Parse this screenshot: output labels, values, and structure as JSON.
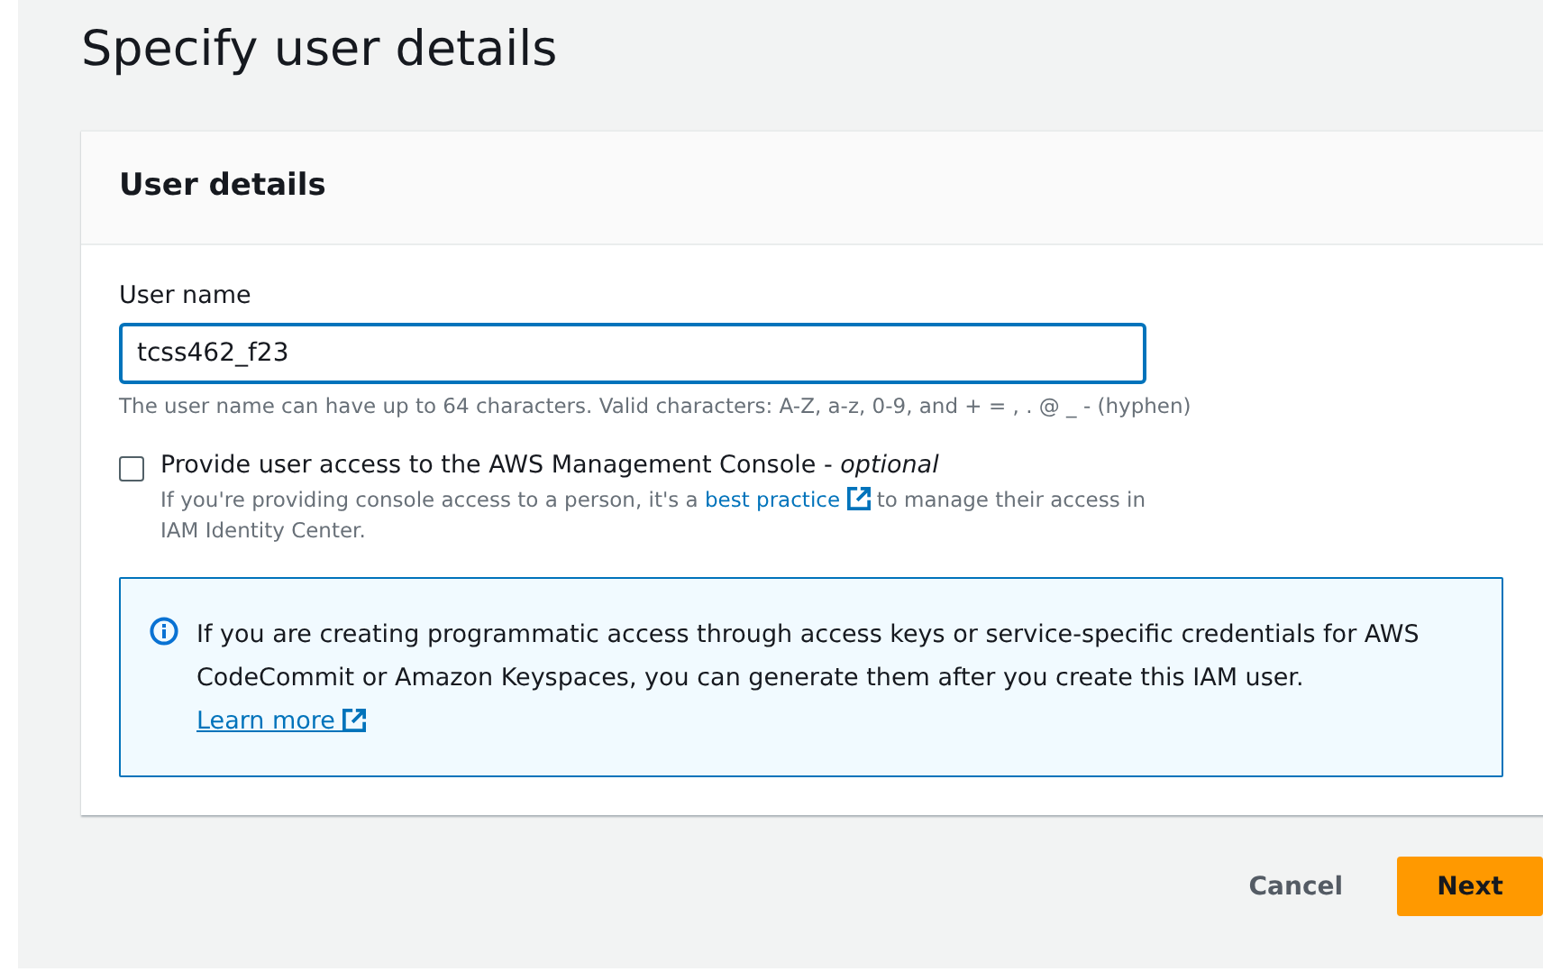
{
  "page_title": "Specify user details",
  "card": {
    "title": "User details",
    "user_name": {
      "label": "User name",
      "value": "tcss462_f23",
      "hint": "The user name can have up to 64 characters. Valid characters: A-Z, a-z, 0-9, and + = , . @ _ - (hyphen)"
    },
    "console_access": {
      "checked": false,
      "label": "Provide user access to the AWS Management Console - ",
      "label_optional": "optional",
      "hint_before": "If you're providing console access to a person, it's a ",
      "hint_link": "best practice",
      "hint_after": " to manage their access in IAM Identity Center."
    },
    "info": {
      "text": "If you are creating programmatic access through access keys or service-specific credentials for AWS CodeCommit or Amazon Keyspaces, you can generate them after you create this IAM user. ",
      "link": "Learn more"
    }
  },
  "buttons": [
    {
      "kind": "link",
      "label": "Cancel"
    },
    {
      "kind": "primary",
      "label": "Next"
    }
  ]
}
